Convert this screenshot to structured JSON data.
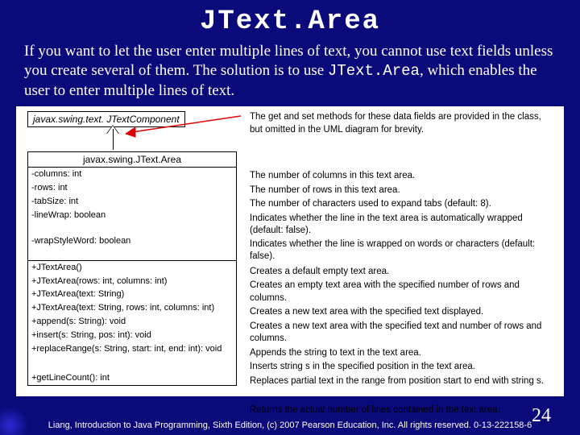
{
  "title": "JText.Area",
  "intro_html": "If you want to let the user enter multiple lines of text, you cannot use text fields unless you create several of them.  The solution is to use <span class='mono'>JText.Area</span>, which enables the user to enter multiple lines of text.",
  "uml": {
    "parent": "javax.swing.text. JTextComponent",
    "child": "javax.swing.JText.Area",
    "attrs": [
      "-columns: int",
      "-rows: int",
      "-tabSize: int",
      "-lineWrap: boolean",
      "-wrapStyleWord: boolean"
    ],
    "ops": [
      "+JTextArea()",
      "+JTextArea(rows: int, columns: int)",
      "+JTextArea(text: String)",
      "+JTextArea(text: String, rows: int, columns: int)",
      "+append(s: String): void",
      "+insert(s: String, pos: int): void",
      "+replaceRange(s: String, start: int, end: int): void",
      "+getLineCount(): int"
    ]
  },
  "desc": {
    "top": "The get and set methods for these data fields are provided in the class, but omitted in the UML diagram for brevity.",
    "attrs": [
      "The number of columns in this text area.",
      "The number of rows in this text area.",
      "The number of characters used to expand tabs (default: 8).",
      "Indicates whether the line in the text area is automatically wrapped (default: false).",
      "Indicates whether the line is wrapped on words or characters (default: false)."
    ],
    "ops": [
      "Creates a default empty text area.",
      "Creates an empty text area with the specified number of rows and columns.",
      "Creates a new text area with the specified text displayed.",
      "Creates a new text area with the specified text and number of rows and columns.",
      "Appends the string to text in the text area.",
      "Inserts string s in the specified position in the text area.",
      "Replaces partial text in the range from position start to end with string s.",
      "Returns the actual number of lines contained in the text area."
    ]
  },
  "footer": "Liang, Introduction to Java Programming, Sixth Edition, (c) 2007 Pearson Education, Inc. All rights reserved. 0-13-222158-6",
  "page": "24"
}
